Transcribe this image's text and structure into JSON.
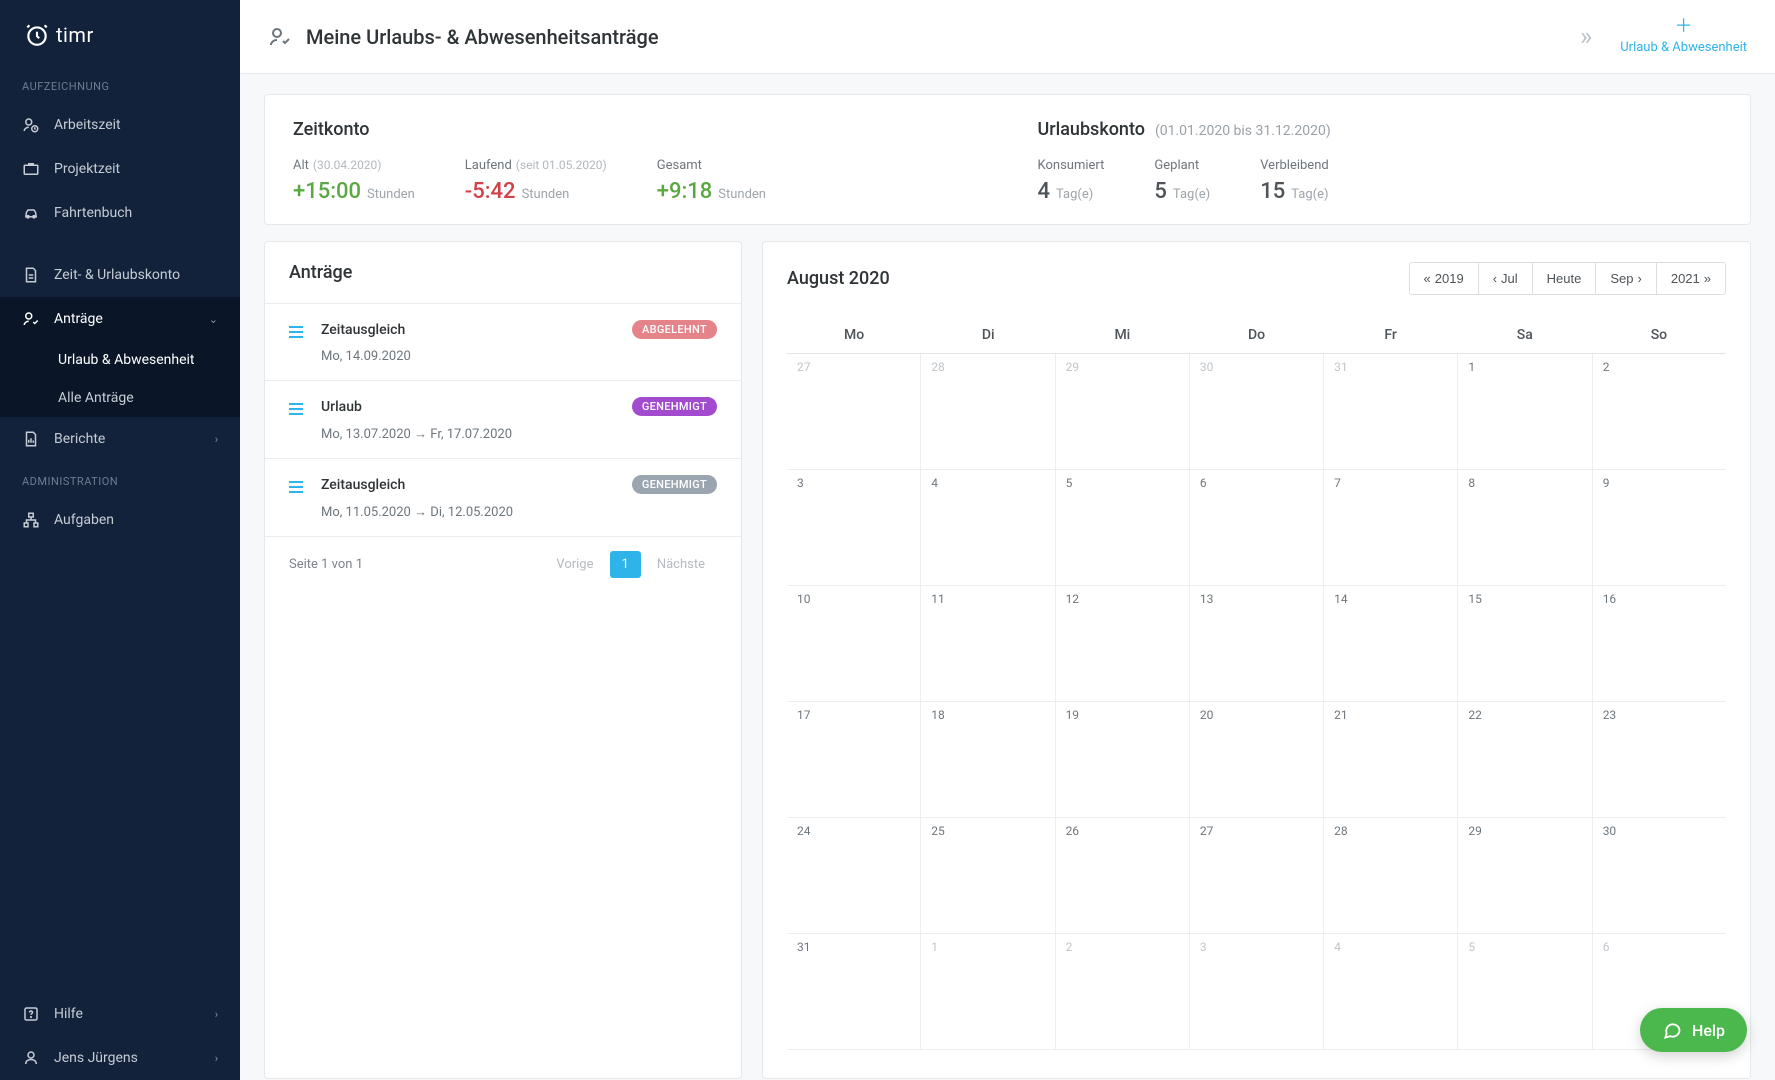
{
  "brand": "timr",
  "sidebar": {
    "sections": {
      "recording": {
        "title": "AUFZEICHNUNG"
      },
      "admin": {
        "title": "ADMINISTRATION"
      }
    },
    "items": {
      "arbeitszeit": "Arbeitszeit",
      "projektzeit": "Projektzeit",
      "fahrtenbuch": "Fahrtenbuch",
      "zeitkonto": "Zeit- & Urlaubskonto",
      "antraege": "Anträge",
      "urlaub_ab": "Urlaub & Abwesenheit",
      "alle_antraege": "Alle Anträge",
      "berichte": "Berichte",
      "aufgaben": "Aufgaben",
      "hilfe": "Hilfe",
      "user": "Jens Jürgens"
    }
  },
  "header": {
    "title": "Meine Urlaubs- & Abwesenheitsanträge",
    "add_label": "Urlaub & Abwesenheit"
  },
  "zeitkonto": {
    "title": "Zeitkonto",
    "alt": {
      "label": "Alt",
      "meta": "(30.04.2020)",
      "value": "+15:00",
      "unit": "Stunden"
    },
    "laufend": {
      "label": "Laufend",
      "meta": "(seit 01.05.2020)",
      "value": "-5:42",
      "unit": "Stunden"
    },
    "gesamt": {
      "label": "Gesamt",
      "value": "+9:18",
      "unit": "Stunden"
    }
  },
  "urlaubskonto": {
    "title": "Urlaubskonto",
    "meta": "(01.01.2020 bis 31.12.2020)",
    "konsumiert": {
      "label": "Konsumiert",
      "value": "4",
      "unit": "Tag(e)"
    },
    "geplant": {
      "label": "Geplant",
      "value": "5",
      "unit": "Tag(e)"
    },
    "verbleibend": {
      "label": "Verbleibend",
      "value": "15",
      "unit": "Tag(e)"
    }
  },
  "requests": {
    "title": "Anträge",
    "items": [
      {
        "type": "Zeitausgleich",
        "date": "Mo, 14.09.2020",
        "status": "ABGELEHNT",
        "status_kind": "rejected"
      },
      {
        "type": "Urlaub",
        "date": "Mo, 13.07.2020  →  Fr, 17.07.2020",
        "status": "GENEHMIGT",
        "status_kind": "approved-purple"
      },
      {
        "type": "Zeitausgleich",
        "date": "Mo, 11.05.2020  →  Di, 12.05.2020",
        "status": "GENEHMIGT",
        "status_kind": "approved-gray"
      }
    ],
    "pagination": {
      "info": "Seite 1 von 1",
      "prev": "Vorige",
      "page": "1",
      "next": "Nächste"
    }
  },
  "calendar": {
    "title": "August 2020",
    "nav": {
      "prev_year": "2019",
      "prev_month": "Jul",
      "today": "Heute",
      "next_month": "Sep",
      "next_year": "2021"
    },
    "dow": [
      "Mo",
      "Di",
      "Mi",
      "Do",
      "Fr",
      "Sa",
      "So"
    ],
    "weeks": [
      [
        {
          "d": "27",
          "o": true
        },
        {
          "d": "28",
          "o": true
        },
        {
          "d": "29",
          "o": true
        },
        {
          "d": "30",
          "o": true
        },
        {
          "d": "31",
          "o": true
        },
        {
          "d": "1"
        },
        {
          "d": "2"
        }
      ],
      [
        {
          "d": "3"
        },
        {
          "d": "4"
        },
        {
          "d": "5"
        },
        {
          "d": "6"
        },
        {
          "d": "7"
        },
        {
          "d": "8"
        },
        {
          "d": "9"
        }
      ],
      [
        {
          "d": "10"
        },
        {
          "d": "11"
        },
        {
          "d": "12"
        },
        {
          "d": "13"
        },
        {
          "d": "14"
        },
        {
          "d": "15"
        },
        {
          "d": "16"
        }
      ],
      [
        {
          "d": "17"
        },
        {
          "d": "18"
        },
        {
          "d": "19"
        },
        {
          "d": "20"
        },
        {
          "d": "21"
        },
        {
          "d": "22"
        },
        {
          "d": "23"
        }
      ],
      [
        {
          "d": "24"
        },
        {
          "d": "25"
        },
        {
          "d": "26"
        },
        {
          "d": "27"
        },
        {
          "d": "28"
        },
        {
          "d": "29"
        },
        {
          "d": "30"
        }
      ],
      [
        {
          "d": "31"
        },
        {
          "d": "1",
          "o": true
        },
        {
          "d": "2",
          "o": true
        },
        {
          "d": "3",
          "o": true
        },
        {
          "d": "4",
          "o": true
        },
        {
          "d": "5",
          "o": true
        },
        {
          "d": "6",
          "o": true
        }
      ]
    ]
  },
  "help": {
    "label": "Help"
  }
}
